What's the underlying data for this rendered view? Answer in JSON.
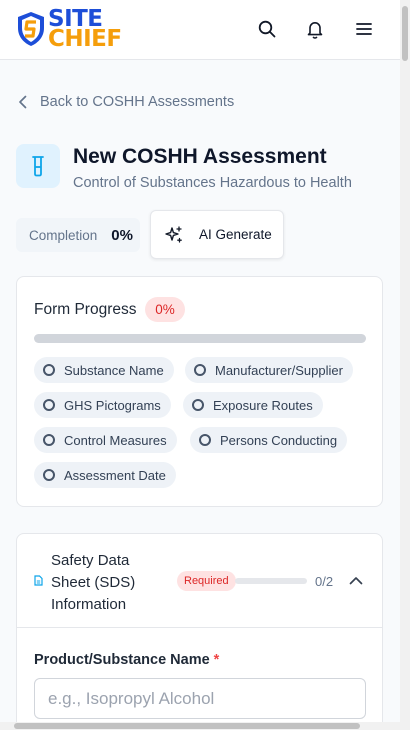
{
  "header": {
    "logo_top": "SITE",
    "logo_bottom": "CHIEF",
    "icons": [
      "search-icon",
      "bell-icon",
      "menu-icon"
    ]
  },
  "back_link": {
    "label": "Back to COSHH Assessments"
  },
  "page": {
    "title": "New COSHH Assessment",
    "subtitle": "Control of Substances Hazardous to Health"
  },
  "completion": {
    "label": "Completion",
    "value": "0%"
  },
  "ai_button": {
    "label": "AI Generate"
  },
  "form_progress": {
    "title": "Form Progress",
    "badge": "0%",
    "percent": 0,
    "items": [
      "Substance Name",
      "Manufacturer/Supplier",
      "GHS Pictograms",
      "Exposure Routes",
      "Control Measures",
      "Persons Conducting",
      "Assessment Date"
    ]
  },
  "sds_section": {
    "title": "Safety Data Sheet (SDS) Information",
    "required_badge": "Required",
    "progress_fraction": 0,
    "count": "0/2"
  },
  "product_field": {
    "label": "Product/Substance Name",
    "required_mark": "*",
    "placeholder": "e.g., Isopropyl Alcohol",
    "value": ""
  },
  "colors": {
    "brand_blue": "#1d4ed8",
    "brand_orange": "#f59e0b",
    "danger": "#dc2626",
    "danger_bg": "#fee2e2"
  }
}
